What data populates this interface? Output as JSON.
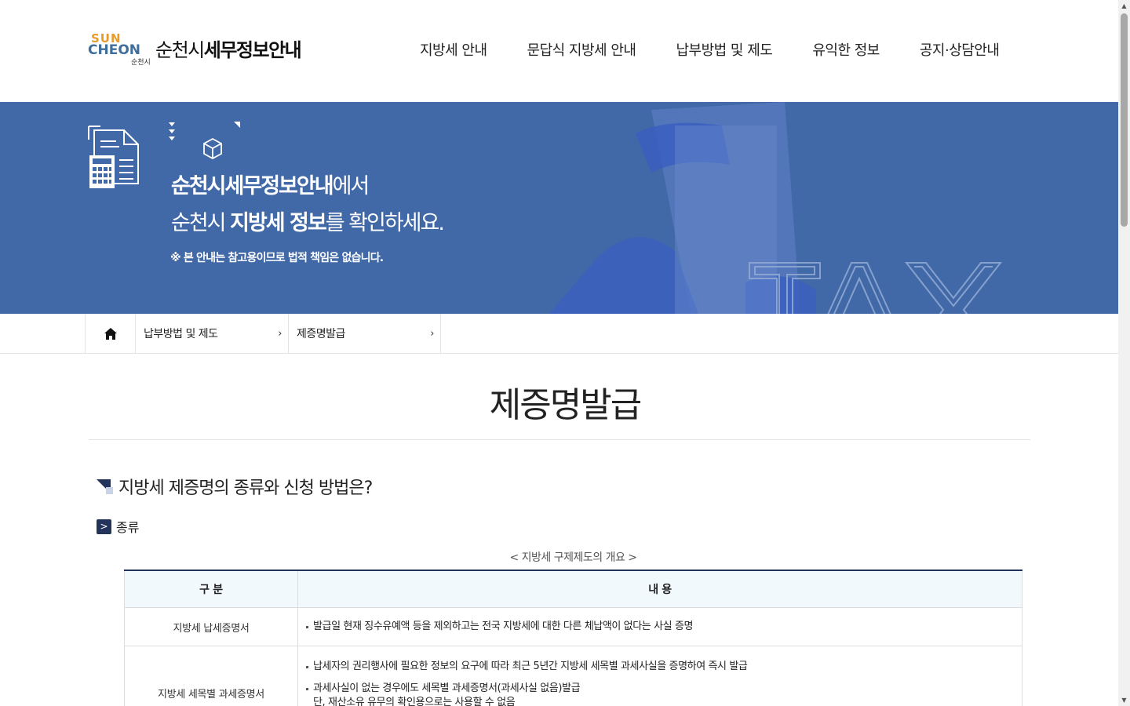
{
  "header": {
    "logo_mark_line1": "SUN",
    "logo_mark_line2": "CHEON",
    "logo_mark_sub": "순천시",
    "logo_text_regular": "순천시",
    "logo_text_bold": "세무정보안내",
    "nav": [
      {
        "label": "지방세 안내"
      },
      {
        "label": "문답식 지방세 안내"
      },
      {
        "label": "납부방법 및 제도"
      },
      {
        "label": "유익한 정보"
      },
      {
        "label": "공지·상담안내"
      }
    ]
  },
  "banner": {
    "line1_bold": "순천시세무정보안내",
    "line1_rest": "에서",
    "line2_pre": "순천시 ",
    "line2_bold": "지방세 정보",
    "line2_rest": "를 확인하세요.",
    "note": "※ 본 안내는 참고용이므로 법적 책임은 없습니다.",
    "tax_text": "TAX"
  },
  "breadcrumb": {
    "home_icon": "home-icon",
    "items": [
      {
        "label": "납부방법 및 제도"
      },
      {
        "label": "제증명발급"
      }
    ]
  },
  "page": {
    "title": "제증명발급",
    "section_heading": "지방세 제증명의 종류와 신청 방법은?",
    "sub_heading_marker": ">",
    "sub_heading": "종류",
    "table_caption": "< 지방세 구제제도의 개요 >"
  },
  "table": {
    "headers": [
      "구 분",
      "내 용"
    ],
    "rows": [
      {
        "category": "지방세 납세증명서",
        "items": [
          "발급일 현재 징수유예액 등을 제외하고는 전국 지방세에 대한 다른 체납액이 없다는 사실 증명"
        ]
      },
      {
        "category": "지방세 세목별 과세증명서",
        "items": [
          "납세자의 권리행사에 필요한 정보의 요구에 따라 최근 5년간 지방세 세목별 과세사실을 증명하여 즉시 발급",
          "과세사실이 없는 경우에도 세목별 과세증명서(과세사실 없음)발급",
          "단, 재산소유 유무의 확인용으로는 사용할 수 없음"
        ]
      }
    ]
  },
  "colors": {
    "banner_bg": "#4169a7",
    "table_top_border": "#233359",
    "table_header_bg": "#f1f9fd"
  }
}
